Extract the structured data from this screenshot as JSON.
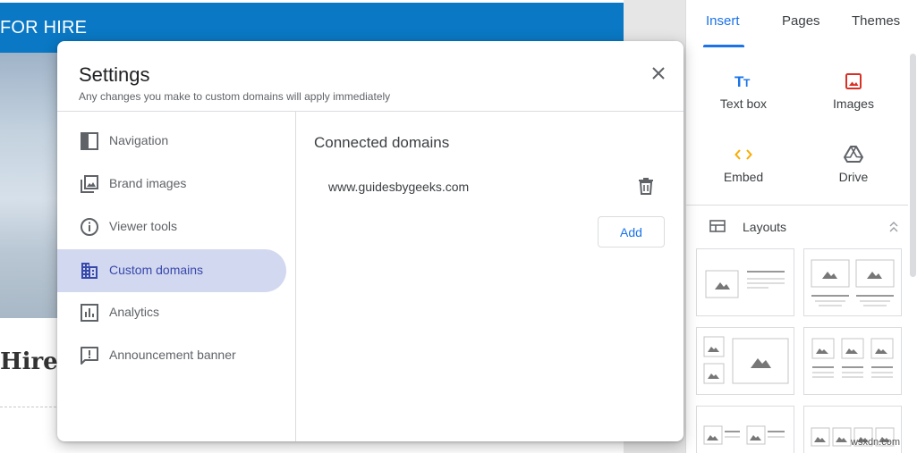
{
  "background_page": {
    "banner_text": "FOR HIRE",
    "heading_fragment": "Hire I",
    "colors": {
      "banner": "#0a78c4"
    }
  },
  "side_panel": {
    "tabs": [
      {
        "label": "Insert",
        "active": true
      },
      {
        "label": "Pages",
        "active": false
      },
      {
        "label": "Themes",
        "active": false
      }
    ],
    "insert_items": [
      {
        "label": "Text box",
        "icon": "text-box-icon"
      },
      {
        "label": "Images",
        "icon": "image-icon"
      },
      {
        "label": "Embed",
        "icon": "embed-code-icon"
      },
      {
        "label": "Drive",
        "icon": "drive-icon"
      }
    ],
    "layouts_label": "Layouts",
    "layout_count_visible": 6
  },
  "dialog": {
    "title": "Settings",
    "subtitle": "Any changes you make to custom domains will apply immediately",
    "nav": [
      {
        "label": "Navigation",
        "icon": "navigation-icon",
        "active": false
      },
      {
        "label": "Brand images",
        "icon": "brand-images-icon",
        "active": false
      },
      {
        "label": "Viewer tools",
        "icon": "info-icon",
        "active": false
      },
      {
        "label": "Custom domains",
        "icon": "domain-icon",
        "active": true
      },
      {
        "label": "Analytics",
        "icon": "analytics-icon",
        "active": false
      },
      {
        "label": "Announcement banner",
        "icon": "announcement-icon",
        "active": false
      }
    ],
    "section_title": "Connected domains",
    "domain": "www.guidesbygeeks.com",
    "add_label": "Add",
    "colors": {
      "accent": "#1a73e8",
      "active_nav_bg": "#d2d8f0",
      "active_nav_text": "#3949ab"
    }
  },
  "watermark": "wsxdn.com"
}
